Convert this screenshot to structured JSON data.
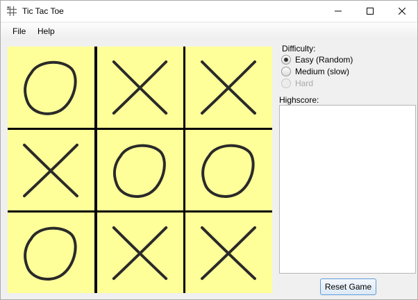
{
  "window": {
    "title": "Tic Tac Toe"
  },
  "menu": {
    "file": "File",
    "help": "Help"
  },
  "board": {
    "cells": [
      [
        "O",
        "X",
        "X"
      ],
      [
        "X",
        "O",
        "O"
      ],
      [
        "O",
        "X",
        "X"
      ]
    ],
    "cell_color": "#ffff99",
    "grid_color": "#000000"
  },
  "difficulty": {
    "label": "Difficulty:",
    "options": [
      {
        "label": "Easy (Random)",
        "selected": true,
        "enabled": true
      },
      {
        "label": "Medium (slow)",
        "selected": false,
        "enabled": true
      },
      {
        "label": "Hard",
        "selected": false,
        "enabled": false
      }
    ]
  },
  "highscore": {
    "label": "Highscore:",
    "entries": []
  },
  "reset_button": {
    "label": "Reset Game"
  },
  "icons": {
    "app": "tic-tac-toe-grid-icon",
    "minimize": "minimize-icon",
    "maximize": "maximize-icon",
    "close": "close-icon"
  }
}
